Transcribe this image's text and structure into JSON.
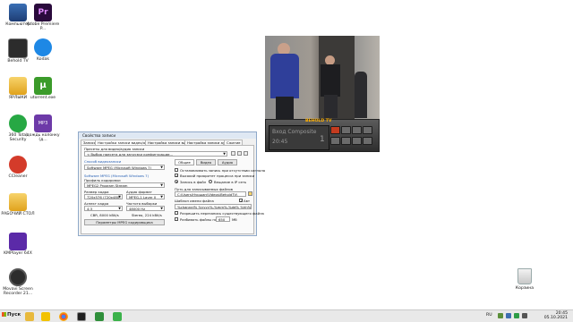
{
  "desktop": {
    "icons": [
      {
        "label": "Компьютер",
        "icon": "computer-icon"
      },
      {
        "label": "Adobe Premiere P...",
        "icon": "adobe-premiere-icon"
      },
      {
        "label": "Behold TV",
        "icon": "behold-tv-icon"
      },
      {
        "label": "Kodak",
        "icon": "kodak-icon"
      },
      {
        "label": "ЯРЛЫКИ",
        "icon": "folder-icon"
      },
      {
        "label": "utorrent.exe",
        "icon": "utorrent-icon"
      },
      {
        "label": "360 Total Security",
        "icon": "360-security-icon"
      },
      {
        "label": "дождь колонку (д...",
        "icon": "mp3-file-icon"
      },
      {
        "label": "CCleaner",
        "icon": "ccleaner-icon"
      },
      {
        "label": "РАБОЧИЙ СТОЛ",
        "icon": "folder-icon"
      },
      {
        "label": "KMPlayer 64X",
        "icon": "kmplayer-icon"
      },
      {
        "label": "Movavi Screen Recorder 21...",
        "icon": "movavi-icon"
      }
    ],
    "recycle_bin_label": "Корзина"
  },
  "tv_window": {
    "brand": "BEHOLD TV",
    "lcd_channel": "Вход Composite",
    "lcd_time": "20:45",
    "lcd_number": "1"
  },
  "dialog": {
    "title": "Свойства записи",
    "tabs": [
      "Запись",
      "Настройка записи видео/аудио",
      "Настройка записи видео",
      "Настройка записи аудио",
      "Сжатие"
    ],
    "presets_label": "Пресеты для видео/аудио записи",
    "preset_value": "< Выбор пресета для загрузки конфигурации...",
    "video_source_label": "Способ видеозаписи",
    "video_source_value": "Software MPEG (Microsoft Windows 7)",
    "encoder_section_label": "Software MPEG (Microsoft Windows 7)",
    "profile_label": "Профиль кодировки",
    "profile_value": "MPEG2 Program Stream",
    "frame_size_label": "Размер кадра",
    "frame_size_value": "720x576 (720x480)",
    "audio_format_label": "Аудио формат",
    "audio_format_value": "MPEG-1 Layer II",
    "aspect_label": "Аспект кадра",
    "aspect_value": "4:3",
    "sample_rate_label": "Частота выборки",
    "sample_rate_value": "48000 Hz",
    "cbr_text": "CBR, 8000 kBit/s",
    "stereo_text": "Stereo, 224 kBit/s",
    "encoder_params_button": "Параметры MPEG кодировщика",
    "right_tabs": [
      "Общие",
      "Видео",
      "Аудио"
    ],
    "options": [
      {
        "label": "Останавливать запись при отсутствии сигнала",
        "checked": false
      },
      {
        "label": "Высокий приоритет процесса при записи",
        "checked": true
      }
    ],
    "radio_file": "Запись в файл",
    "radio_ip": "Вещание в IP сеть",
    "path_label": "Путь для записываемых файлов",
    "path_value": "C:\\Users\\Нуршан\\Videos\\BeholdTV\\",
    "template_label": "Шаблон имени файла",
    "template_checkbox": "Авт",
    "template_value": "%channel% %yyyy%-%mm%-%dd% %hh%-%nn%",
    "overwrite_label": "Разрешить перезапись существующего файла",
    "split_label": "Разбивать файлы по",
    "split_value": "650",
    "split_unit": "Мб"
  },
  "taskbar": {
    "start_label": "Пуск",
    "lang": "RU",
    "time": "20:45",
    "date": "05.10.2021"
  }
}
